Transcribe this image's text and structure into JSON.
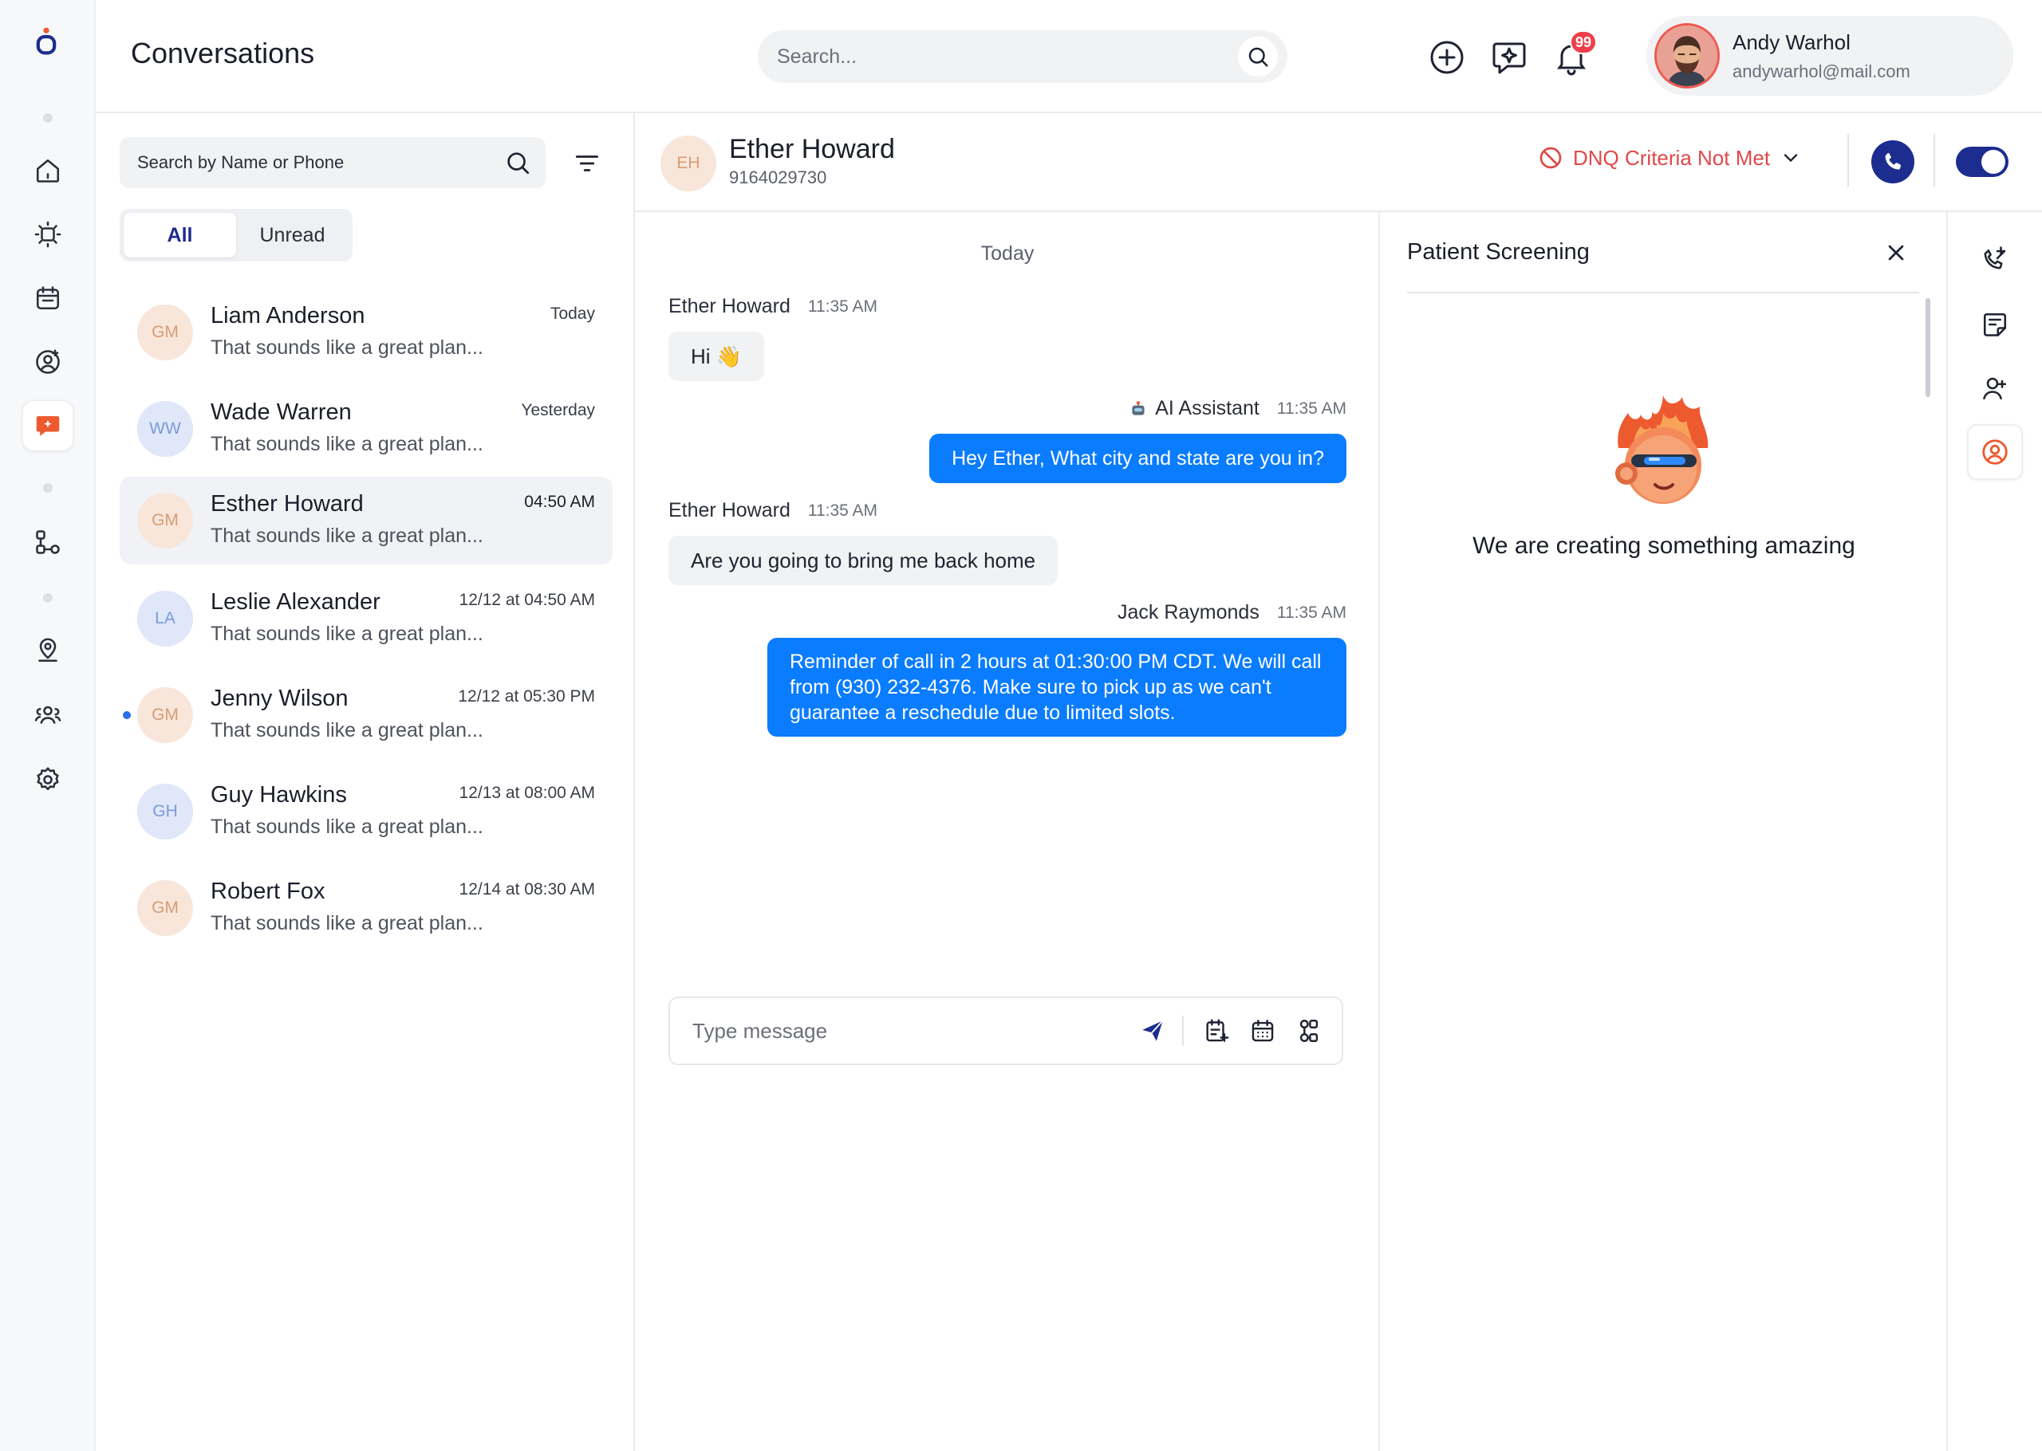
{
  "app": {
    "accent_color": "#1d2c8f",
    "brand_color": "#ee5a2f"
  },
  "sidebar": {
    "items": [
      {
        "icon": "home-icon"
      },
      {
        "icon": "dashboard-icon"
      },
      {
        "icon": "calendar-icon"
      },
      {
        "icon": "contact-add-icon"
      },
      {
        "icon": "conversations-icon",
        "active": true
      },
      {
        "icon": "workflow-icon"
      },
      {
        "icon": "location-icon"
      },
      {
        "icon": "team-icon"
      },
      {
        "icon": "settings-icon"
      }
    ]
  },
  "header": {
    "title": "Conversations",
    "search_placeholder": "Search...",
    "notifications_count": "99",
    "user": {
      "name": "Andy Warhol",
      "email": "andywarhol@mail.com"
    }
  },
  "list": {
    "search_placeholder": "Search by Name or Phone",
    "tabs": [
      {
        "label": "All",
        "active": true
      },
      {
        "label": "Unread",
        "active": false
      }
    ],
    "conversations": [
      {
        "initials": "GM",
        "name": "Liam Anderson",
        "preview": "That sounds like a great plan...",
        "time": "Today",
        "color": "orange"
      },
      {
        "initials": "WW",
        "name": "Wade Warren",
        "preview": "That sounds like a great plan...",
        "time": "Yesterday",
        "color": "blue"
      },
      {
        "initials": "GM",
        "name": "Esther Howard",
        "preview": "That sounds like a great plan...",
        "time": "04:50 AM",
        "color": "orange",
        "selected": true
      },
      {
        "initials": "LA",
        "name": "Leslie Alexander",
        "preview": "That sounds like a great plan...",
        "time": "12/12 at 04:50 AM",
        "color": "blue"
      },
      {
        "initials": "GM",
        "name": "Jenny Wilson",
        "preview": "That sounds like a great plan...",
        "time": "12/12 at 05:30 PM",
        "color": "orange",
        "unread": true
      },
      {
        "initials": "GH",
        "name": "Guy Hawkins",
        "preview": "That sounds like a great plan...",
        "time": "12/13 at 08:00 AM",
        "color": "blue"
      },
      {
        "initials": "GM",
        "name": "Robert Fox",
        "preview": "That sounds like a great plan...",
        "time": "12/14 at 08:30 AM",
        "color": "orange"
      }
    ]
  },
  "chat": {
    "contact": {
      "initials": "EH",
      "name": "Ether Howard",
      "phone": "9164029730"
    },
    "status": {
      "label": "DNQ Criteria Not Met",
      "color": "#e04848"
    },
    "day_label": "Today",
    "messages": [
      {
        "sender": "Ether Howard",
        "time": "11:35 AM",
        "text": "Hi 👋",
        "direction": "in"
      },
      {
        "sender": "AI Assistant",
        "time": "11:35 AM",
        "text": "Hey Ether, What city and state are you in?",
        "direction": "out"
      },
      {
        "sender": "Ether Howard",
        "time": "11:35 AM",
        "text": "Are you going to bring me back home",
        "direction": "in"
      },
      {
        "sender": "Jack Raymonds",
        "time": "11:35 AM",
        "text": "Reminder of call in 2 hours at 01:30:00 PM CDT. We will call from (930) 232-4376. Make sure to pick up as we can't guarantee a reschedule due to limited slots.",
        "direction": "out"
      }
    ],
    "composer_placeholder": "Type message"
  },
  "screening": {
    "title": "Patient Screening",
    "message": "We are creating something amazing"
  },
  "tools": [
    {
      "icon": "call-log-icon"
    },
    {
      "icon": "notes-icon"
    },
    {
      "icon": "assign-user-icon"
    },
    {
      "icon": "patient-profile-icon",
      "active": true
    }
  ]
}
